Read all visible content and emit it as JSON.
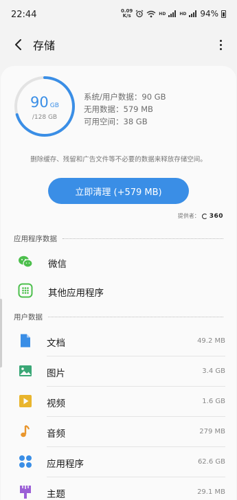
{
  "status_bar": {
    "time": "22:44",
    "net_speed_value": "0.09",
    "net_speed_unit": "K/s",
    "battery": "94%",
    "icons": [
      "net-speed",
      "alarm-icon",
      "wifi-icon",
      "hd-icon",
      "signal-4g-icon",
      "hd-icon",
      "signal-4g-icon",
      "battery-icon"
    ]
  },
  "app_bar": {
    "title": "存储",
    "back_icon": "back-arrow-icon",
    "more_icon": "more-vert-icon"
  },
  "summary": {
    "used_value": "90",
    "used_unit": "GB",
    "total": "/128 GB",
    "used_fraction": 0.703,
    "accent_color": "#3a8ee6",
    "stats": [
      "系统/用户数据：90 GB",
      "无用数据：579 MB",
      "可用空间：38 GB"
    ]
  },
  "hint": "删除缓存、残留和广告文件等不必要的数据来释放存储空间。",
  "clean_button": "立即清理 (+579 MB)",
  "provider": {
    "label": "提供者：",
    "logo_text": "360"
  },
  "app_section": {
    "title": "应用程序数据",
    "items": [
      {
        "label": "微信",
        "icon": "wechat-icon"
      },
      {
        "label": "其他应用程序",
        "icon": "apps-grid-icon"
      }
    ]
  },
  "user_section": {
    "title": "用户数据",
    "items": [
      {
        "label": "文档",
        "size": "49.2 MB",
        "icon": "document-icon"
      },
      {
        "label": "图片",
        "size": "3.4 GB",
        "icon": "image-icon"
      },
      {
        "label": "视频",
        "size": "1.6 GB",
        "icon": "video-icon"
      },
      {
        "label": "音频",
        "size": "279 MB",
        "icon": "music-note-icon"
      },
      {
        "label": "应用程序",
        "size": "62.6 GB",
        "icon": "apps-icon"
      },
      {
        "label": "主题",
        "size": "29.1 MB",
        "icon": "theme-brush-icon"
      }
    ]
  }
}
